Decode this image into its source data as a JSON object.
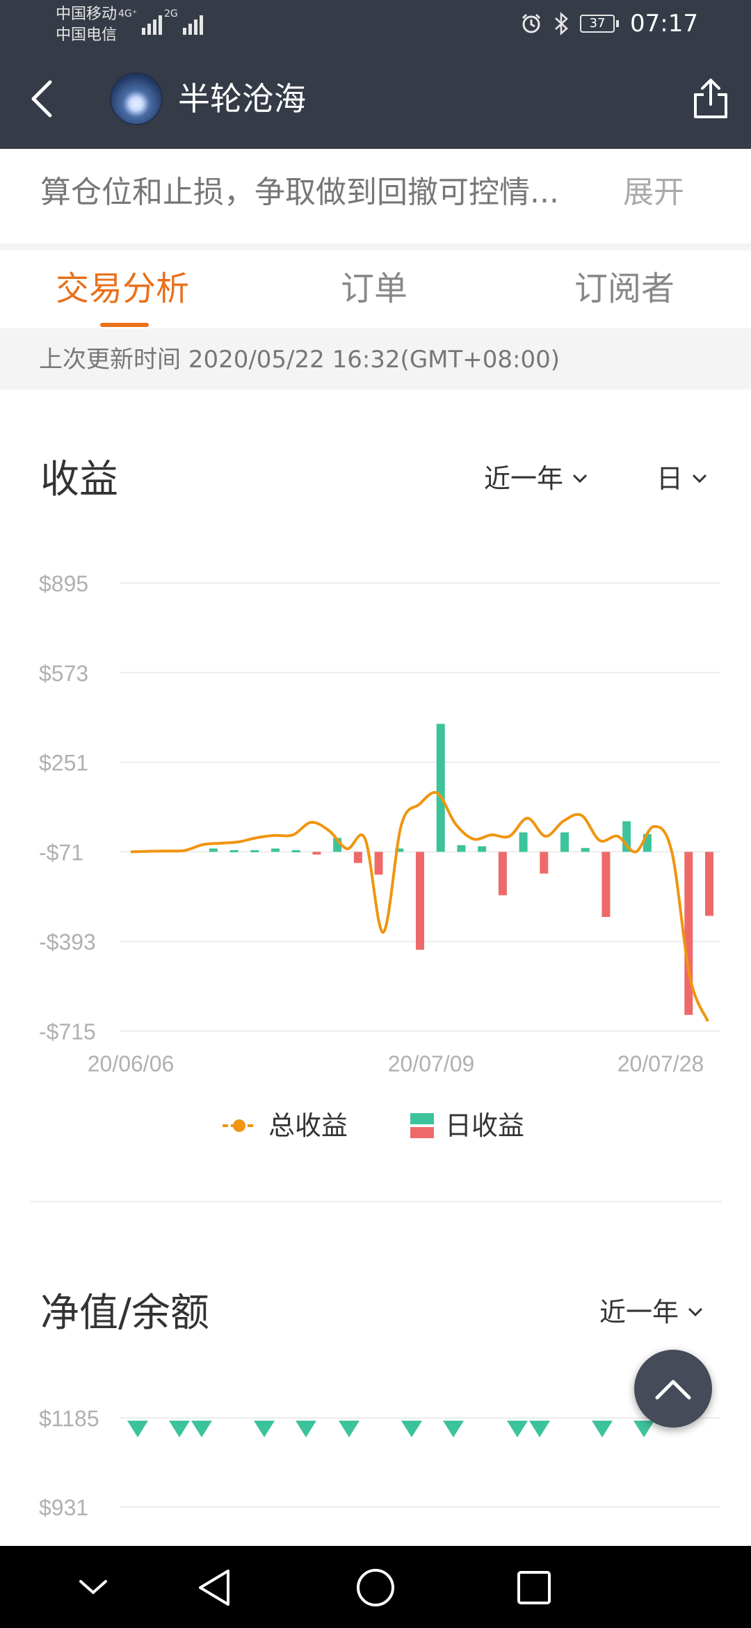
{
  "status_bar": {
    "carrier_1": "中国移动",
    "carrier_2": "中国电信",
    "network_1": "4G⁺",
    "network_2": "2G",
    "battery": "37",
    "time": "07:17"
  },
  "header": {
    "title": "半轮沧海",
    "back_icon": "chevron-left-icon",
    "share_icon": "share-icon"
  },
  "bio": {
    "text": "算仓位和止损，争取做到回撤可控情...",
    "expand_label": "展开"
  },
  "tabs": [
    {
      "label": "交易分析",
      "active": true
    },
    {
      "label": "订单",
      "active": false
    },
    {
      "label": "订阅者",
      "active": false
    }
  ],
  "last_update": "上次更新时间 2020/05/22 16:32(GMT+08:00)",
  "earnings": {
    "title": "收益",
    "range_filter": "近一年",
    "interval_filter": "日",
    "legend_total": "总收益",
    "legend_daily": "日收益"
  },
  "net_value": {
    "title": "净值/余额",
    "range_filter": "近一年"
  },
  "colors": {
    "accent": "#e8711a",
    "line": "#f0950f",
    "positive": "#3cc39b",
    "negative": "#ee6a6a",
    "header_bg": "#353b47"
  },
  "chart_data": [
    {
      "type": "bar",
      "title": "收益",
      "y_ticks": [
        "$895",
        "$573",
        "$251",
        "-$71",
        "-$393",
        "-$715"
      ],
      "ylim": [
        -715,
        895
      ],
      "x_labels": [
        "20/06/06",
        "20/07/09",
        "20/07/28"
      ],
      "grid": true,
      "legend": "bottom",
      "series": [
        {
          "name": "总收益",
          "type": "line",
          "color": "#f0950f",
          "values": [
            -71,
            -69,
            -68,
            -66,
            -45,
            -40,
            -35,
            -20,
            -12,
            -10,
            35,
            5,
            -60,
            -25,
            -360,
            25,
            100,
            140,
            30,
            -25,
            -10,
            -15,
            50,
            -15,
            40,
            60,
            -30,
            -15,
            -71,
            20,
            -71,
            -520,
            -680
          ]
        },
        {
          "name": "日收益",
          "type": "bar",
          "values": [
            -71,
            0,
            0,
            0,
            12,
            6,
            6,
            12,
            6,
            -10,
            50,
            -40,
            -82,
            12,
            -352,
            460,
            24,
            20,
            -156,
            70,
            -78,
            70,
            14,
            -234,
            110,
            64,
            0,
            -586,
            -230
          ]
        }
      ]
    },
    {
      "type": "scatter",
      "title": "净值/余额",
      "y_ticks": [
        "$1185",
        "$931"
      ],
      "grid": true,
      "series": [
        {
          "name": "",
          "marker": "triangle-down",
          "color": "#3cc39b",
          "values": [
            1185,
            1185,
            1185,
            1185,
            1185,
            1185,
            1185,
            1185,
            1185,
            1185,
            1185,
            1185
          ]
        }
      ]
    }
  ]
}
